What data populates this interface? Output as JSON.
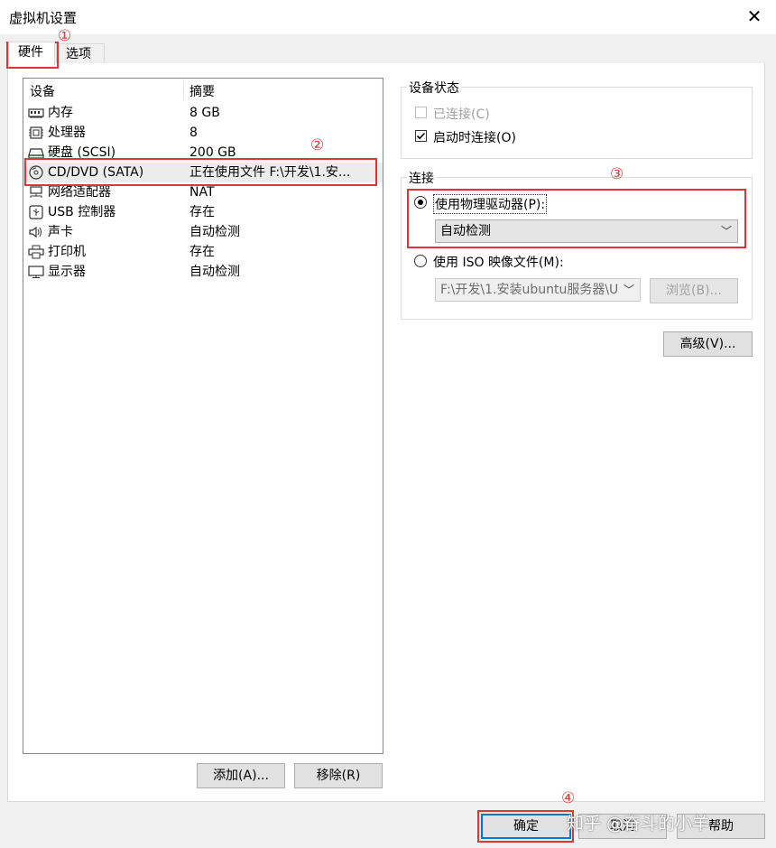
{
  "window": {
    "title": "虚拟机设置"
  },
  "tabs": [
    {
      "label": "硬件",
      "active": true
    },
    {
      "label": "选项",
      "active": false
    }
  ],
  "device_list": {
    "headers": {
      "device": "设备",
      "summary": "摘要"
    },
    "rows": [
      {
        "icon": "memory-icon",
        "name": "内存",
        "summary": "8 GB"
      },
      {
        "icon": "processor-icon",
        "name": "处理器",
        "summary": "8"
      },
      {
        "icon": "harddisk-icon",
        "name": "硬盘 (SCSI)",
        "summary": "200 GB"
      },
      {
        "icon": "cd-dvd-icon",
        "name": "CD/DVD (SATA)",
        "summary": "正在使用文件 F:\\开发\\1.安...",
        "selected": true
      },
      {
        "icon": "network-adapter-icon",
        "name": "网络适配器",
        "summary": "NAT"
      },
      {
        "icon": "usb-icon",
        "name": "USB 控制器",
        "summary": "存在"
      },
      {
        "icon": "sound-icon",
        "name": "声卡",
        "summary": "自动检测"
      },
      {
        "icon": "printer-icon",
        "name": "打印机",
        "summary": "存在"
      },
      {
        "icon": "display-icon",
        "name": "显示器",
        "summary": "自动检测"
      }
    ]
  },
  "list_buttons": {
    "add": "添加(A)...",
    "remove": "移除(R)"
  },
  "device_status": {
    "title": "设备状态",
    "connected": {
      "label": "已连接(C)",
      "checked": false,
      "disabled": true
    },
    "connect_on_power_on": {
      "label": "启动时连接(O)",
      "checked": true
    }
  },
  "connection": {
    "title": "连接",
    "physical_drive": {
      "label": "使用物理驱动器(P):",
      "selected": true,
      "value": "自动检测"
    },
    "iso_image": {
      "label": "使用 ISO 映像文件(M):",
      "selected": false,
      "path": "F:\\开发\\1.安装ubuntu服务器\\U",
      "browse_label": "浏览(B)..."
    }
  },
  "advanced_button": "高级(V)...",
  "footer_buttons": {
    "ok": "确定",
    "cancel": "取消",
    "help": "帮助"
  },
  "annotations": [
    "①",
    "②",
    "③",
    "④"
  ],
  "watermark": "知乎 @奋斗的小羊",
  "colors": {
    "annotation_red": "#d9383a",
    "focus_blue": "#0078d7"
  }
}
